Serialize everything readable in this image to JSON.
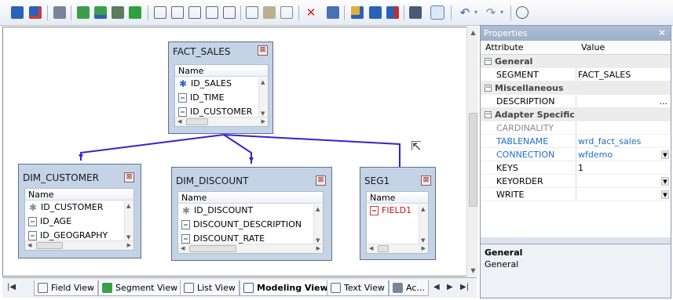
{
  "toolbar": {
    "buttons": [
      "save-icon",
      "save-as-icon",
      "print-icon",
      "segment-icon",
      "segment-add-icon",
      "cross-reference-icon",
      "segment-green-icon",
      "field-icon",
      "field-up-icon",
      "field-down-icon",
      "field-edit-icon",
      "field-list-icon",
      "sort-icon",
      "edit-pencil-icon",
      "document-icon",
      "delete-icon",
      "copy-icon",
      "join-icon",
      "hierarchy-icon",
      "relation-icon",
      "tree-icon",
      "pointer-icon",
      "undo-icon",
      "redo-icon",
      "zoom-icon"
    ]
  },
  "segments": {
    "fact_sales": {
      "title": "FACT_SALES",
      "header": "Name",
      "rows": [
        "ID_SALES",
        "ID_TIME",
        "ID_CUSTOMER"
      ]
    },
    "dim_customer": {
      "title": "DIM_CUSTOMER",
      "header": "Name",
      "rows": [
        "ID_CUSTOMER",
        "ID_AGE",
        "ID_GEOGRAPHY"
      ]
    },
    "dim_discount": {
      "title": "DIM_DISCOUNT",
      "header": "Name",
      "rows": [
        "ID_DISCOUNT",
        "DISCOUNT_DESCRIPTION",
        "DISCOUNT_RATE"
      ]
    },
    "seg1": {
      "title": "SEG1",
      "header": "Name",
      "rows": [
        "FIELD1"
      ]
    }
  },
  "tabs": {
    "field_view": "Field View",
    "segment_view": "Segment View",
    "list_view": "List View",
    "modeling_view": "Modeling View",
    "text_view": "Text View",
    "access": "Ac..."
  },
  "properties": {
    "title": "Properties",
    "col_attribute": "Attribute",
    "col_value": "Value",
    "groups": {
      "general": "General",
      "misc": "Miscellaneous",
      "adapter": "Adapter Specific"
    },
    "rows": {
      "segment": {
        "k": "SEGMENT",
        "v": "FACT_SALES"
      },
      "description": {
        "k": "DESCRIPTION",
        "v": "",
        "btn": "..."
      },
      "cardinality": {
        "k": "CARDINALITY",
        "v": ""
      },
      "tablename": {
        "k": "TABLENAME",
        "v": "wrd_fact_sales"
      },
      "connection": {
        "k": "CONNECTION",
        "v": "wfdemo"
      },
      "keys": {
        "k": "KEYS",
        "v": "1"
      },
      "keyorder": {
        "k": "KEYORDER",
        "v": ""
      },
      "write": {
        "k": "WRITE",
        "v": ""
      }
    },
    "desc_title": "General",
    "desc_text": "General"
  },
  "colors": {
    "connector": "#3a1fd0",
    "accent_blue": "#1d6fc9",
    "segment_bg": "#c4d3e6",
    "field_red": "#d01010"
  }
}
